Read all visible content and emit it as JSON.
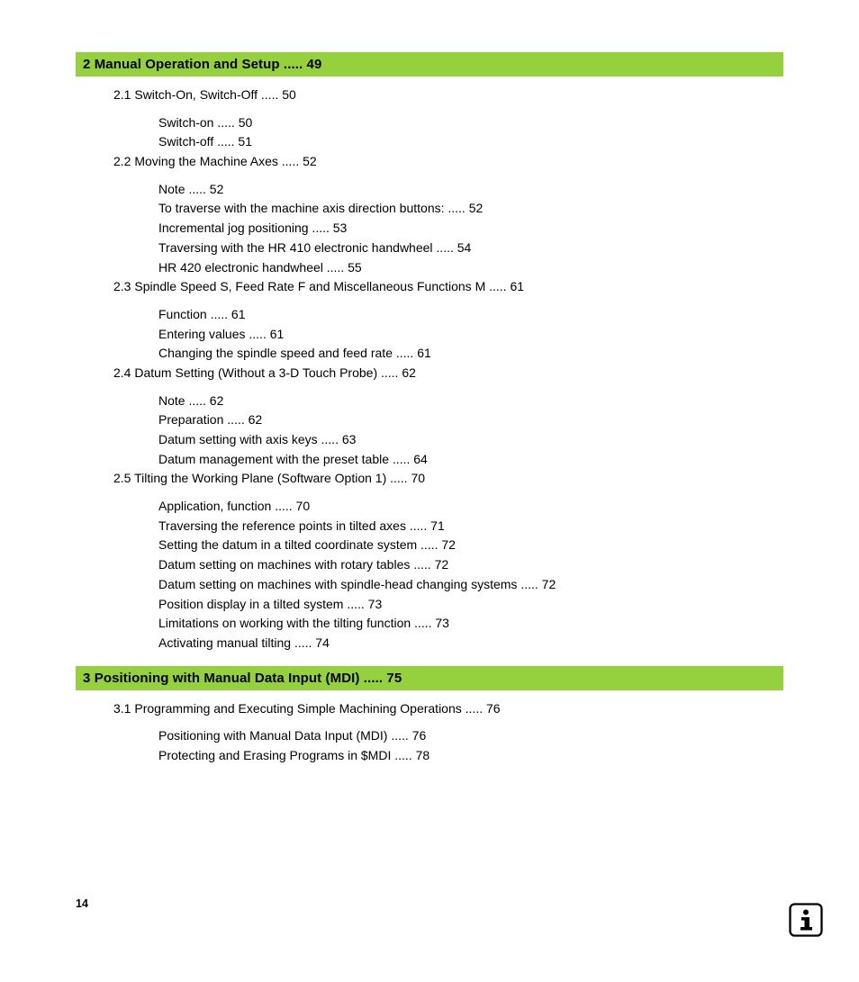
{
  "dots": " ..... ",
  "page_number": "14",
  "sections": [
    {
      "number": "2",
      "title": "Manual Operation and Setup",
      "page": "49",
      "subsections": [
        {
          "number": "2.1",
          "title": "Switch-On, Switch-Off",
          "page": "50",
          "label_style": "spaced",
          "children": [
            {
              "title": "Switch-on",
              "page": "50"
            },
            {
              "title": "Switch-off",
              "page": "51"
            }
          ]
        },
        {
          "number": "2.2",
          "title": "Moving the Machine Axes",
          "page": "52",
          "label_style": "spaced",
          "children": [
            {
              "title": "Note",
              "page": "52"
            },
            {
              "title": "To traverse with the machine axis direction buttons:",
              "page": "52"
            },
            {
              "title": "Incremental jog positioning",
              "page": "53"
            },
            {
              "title": "Traversing with the HR 410 electronic handwheel",
              "page": "54"
            },
            {
              "title": "HR 420 electronic handwheel",
              "page": "55"
            }
          ]
        },
        {
          "number": "2.3",
          "title": "Spindle Speed S, Feed Rate F and Miscellaneous Functions M",
          "page": "61",
          "label_style": "tight",
          "children": [
            {
              "title": "Function",
              "page": "61"
            },
            {
              "title": "Entering values",
              "page": "61"
            },
            {
              "title": "Changing the spindle speed and feed rate",
              "page": "61"
            }
          ]
        },
        {
          "number": "2.4",
          "title": "Datum Setting (Without a 3-D Touch Probe)",
          "page": "62",
          "label_style": "tight",
          "children": [
            {
              "title": "Note",
              "page": "62"
            },
            {
              "title": "Preparation",
              "page": "62"
            },
            {
              "title": "Datum setting with axis keys",
              "page": "63"
            },
            {
              "title": "Datum management with the preset table",
              "page": "64"
            }
          ]
        },
        {
          "number": "2.5",
          "title": "Tilting the Working Plane (Software Option 1)",
          "page": "70",
          "label_style": "tight",
          "children": [
            {
              "title": "Application, function",
              "page": "70"
            },
            {
              "title": "Traversing the reference points in tilted axes",
              "page": "71"
            },
            {
              "title": "Setting the datum in a tilted coordinate system",
              "page": "72"
            },
            {
              "title": "Datum setting on machines with rotary tables",
              "page": "72"
            },
            {
              "title": "Datum setting on machines with spindle-head changing systems",
              "page": "72"
            },
            {
              "title": "Position display in a tilted system",
              "page": "73"
            },
            {
              "title": "Limitations on working with the tilting function",
              "page": "73"
            },
            {
              "title": "Activating manual tilting",
              "page": "74"
            }
          ]
        }
      ]
    },
    {
      "number": "3",
      "title": "Positioning with Manual Data Input (MDI)",
      "page": "75",
      "subsections": [
        {
          "number": "3.1",
          "title": "Programming and Executing Simple Machining Operations",
          "page": "76",
          "label_style": "tight",
          "children": [
            {
              "title": "Positioning with Manual Data Input (MDI)",
              "page": "76"
            },
            {
              "title": "Protecting and Erasing Programs in $MDI",
              "page": "78"
            }
          ]
        }
      ]
    }
  ]
}
